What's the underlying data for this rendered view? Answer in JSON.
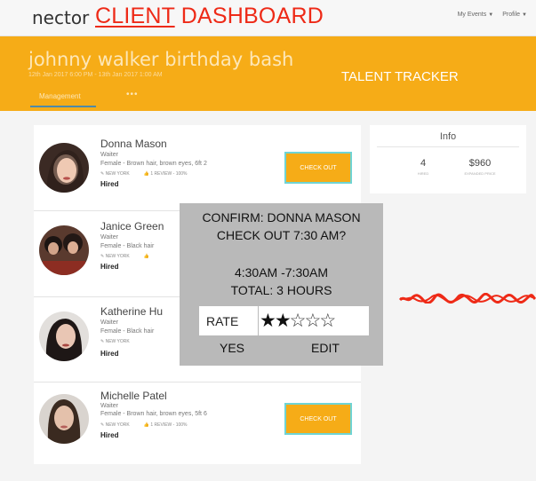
{
  "header": {
    "brand": "nector",
    "title_underlined": "CLIENT",
    "title_rest": " DASHBOARD",
    "nav": [
      {
        "label": "My Events"
      },
      {
        "label": "Profile"
      }
    ]
  },
  "banner": {
    "event_title": "johnny walker birthday bash",
    "event_dates": "12th Jan 2017 6:00 PM - 13th Jan 2017 1:00 AM",
    "annotation": "TALENT TRACKER",
    "tabs": [
      {
        "label": "Management"
      },
      {
        "label": "•••"
      }
    ]
  },
  "talent": [
    {
      "name": "Donna Mason",
      "role": "Waiter",
      "desc": "Female - Brown hair, brown eyes, 6ft 2",
      "location": "NEW YORK",
      "reviews": "1 REVIEW - 100%",
      "status": "Hired",
      "action": "CHECK OUT"
    },
    {
      "name": "Janice Green",
      "role": "Waiter",
      "desc": "Female - Black hair",
      "location": "NEW YORK",
      "reviews": "",
      "status": "Hired",
      "action": ""
    },
    {
      "name": "Katherine Hu",
      "role": "Waiter",
      "desc": "Female - Black hair",
      "location": "NEW YORK",
      "reviews": "",
      "status": "Hired",
      "action": ""
    },
    {
      "name": "Michelle Patel",
      "role": "Waiter",
      "desc": "Female - Brown hair, brown eyes, 5ft 6",
      "location": "NEW YORK",
      "reviews": "1 REVIEW - 100%",
      "status": "Hired",
      "action": "CHECK OUT"
    }
  ],
  "info": {
    "title": "Info",
    "stats": [
      {
        "value": "4",
        "label": "HIRED"
      },
      {
        "value": "$960",
        "label": "EXPANDED PRICE"
      }
    ]
  },
  "dialog": {
    "line1": "CONFIRM: DONNA MASON",
    "line2": "CHECK OUT 7:30 AM?",
    "line3": "4:30AM -7:30AM",
    "line4": "TOTAL: 3 HOURS",
    "rate_label": "RATE",
    "rating": 2,
    "rating_max": 5,
    "yes_label": "YES",
    "edit_label": "EDIT"
  },
  "colors": {
    "brand_orange": "#f6ac17",
    "annotation_red": "#ee2a17",
    "dialog_gray": "#b9b9b9",
    "button_border": "#6fd4d4"
  }
}
